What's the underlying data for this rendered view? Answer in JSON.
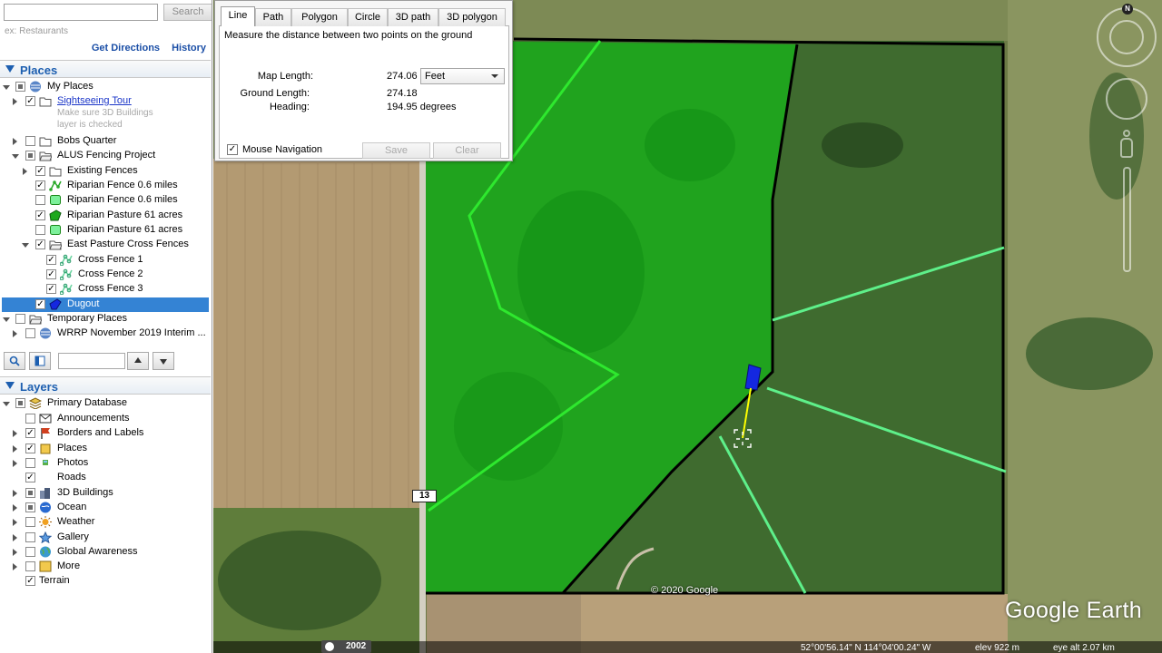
{
  "search": {
    "placeholder": "",
    "button_label": "Search",
    "hint": "ex: Restaurants",
    "get_directions": "Get Directions",
    "history": "History"
  },
  "places": {
    "header": "Places",
    "items": [
      {
        "label": "My Places"
      },
      {
        "label": "Sightseeing Tour",
        "note1": "Make sure 3D Buildings",
        "note2": "layer is checked"
      },
      {
        "label": "Bobs Quarter"
      },
      {
        "label": "ALUS Fencing Project"
      },
      {
        "label": "Existing Fences"
      },
      {
        "label": "Riparian Fence 0.6 miles"
      },
      {
        "label": "Riparian Fence 0.6 miles"
      },
      {
        "label": "Riparian Pasture 61 acres"
      },
      {
        "label": "Riparian Pasture 61 acres"
      },
      {
        "label": "East Pasture Cross Fences"
      },
      {
        "label": "Cross Fence 1"
      },
      {
        "label": "Cross Fence 2"
      },
      {
        "label": "Cross Fence 3"
      },
      {
        "label": "Dugout"
      },
      {
        "label": "Temporary Places"
      },
      {
        "label": "WRRP November 2019 Interim ..."
      }
    ]
  },
  "layers": {
    "header": "Layers",
    "items": [
      {
        "label": "Primary Database"
      },
      {
        "label": "Announcements"
      },
      {
        "label": "Borders and Labels"
      },
      {
        "label": "Places"
      },
      {
        "label": "Photos"
      },
      {
        "label": "Roads"
      },
      {
        "label": "3D Buildings"
      },
      {
        "label": "Ocean"
      },
      {
        "label": "Weather"
      },
      {
        "label": "Gallery"
      },
      {
        "label": "Global Awareness"
      },
      {
        "label": "More"
      },
      {
        "label": "Terrain"
      }
    ]
  },
  "ruler": {
    "tabs": [
      "Line",
      "Path",
      "Polygon",
      "Circle",
      "3D path",
      "3D polygon"
    ],
    "active_tab": "Line",
    "description": "Measure the distance between two points on the ground",
    "map_length_label": "Map Length:",
    "map_length_value": "274.06",
    "unit": "Feet",
    "ground_length_label": "Ground Length:",
    "ground_length_value": "274.18",
    "heading_label": "Heading:",
    "heading_value": "194.95 degrees",
    "mouse_nav_label": "Mouse Navigation",
    "mouse_nav_checked": "✓",
    "save_label": "Save",
    "clear_label": "Clear"
  },
  "map": {
    "route_number": "13",
    "copyright": "© 2020 Google",
    "logo": "Google Earth",
    "historical_year": "2002",
    "coords": "52°00'56.14\" N  114°04'00.24\" W",
    "elevation": "elev  922 m",
    "eye_alt": "eye alt  2.07 km",
    "compass_n": "N",
    "colors": {
      "pasture_fill": "#17b51a",
      "fence_bright": "#2ee82e",
      "fence_light": "#5ef08a",
      "boundary": "#000000",
      "dugout": "#1428e0",
      "measure_line": "#ffff00"
    }
  }
}
